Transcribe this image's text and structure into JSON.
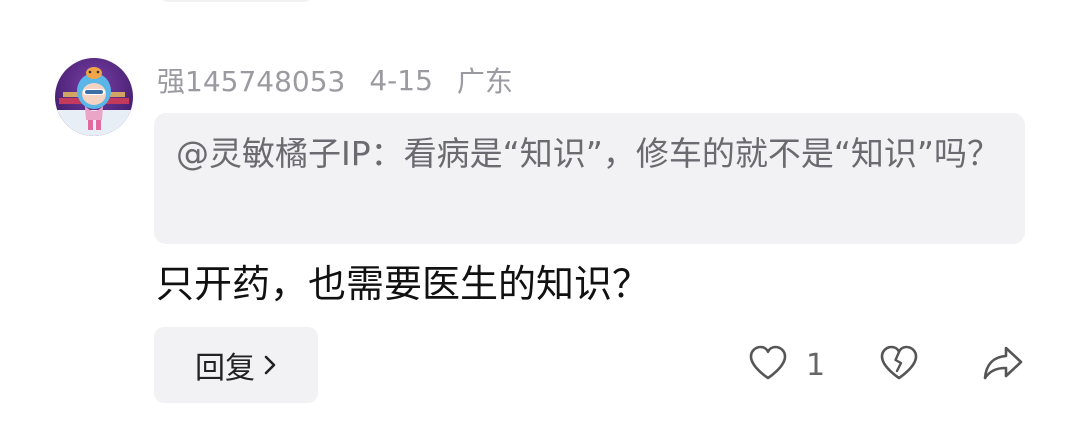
{
  "comment": {
    "username": "强145748053",
    "date": "4-15",
    "region": "广东",
    "quoted_text": "@灵敏橘子IP：看病是“知识”，修车的就不是“知识”吗？",
    "text": "只开药，也需要医生的知识？",
    "reply_label": "回复",
    "like_count": "1"
  },
  "icons": {
    "reply": "chevron-right-icon",
    "like": "heart-outline-icon",
    "dislike": "broken-heart-icon",
    "share": "share-arrow-icon"
  },
  "colors": {
    "meta_text": "#9a9aa0",
    "quote_bg": "#f2f2f4",
    "quote_text": "#6a6a70",
    "body_text": "#111111",
    "icon": "#555555"
  }
}
